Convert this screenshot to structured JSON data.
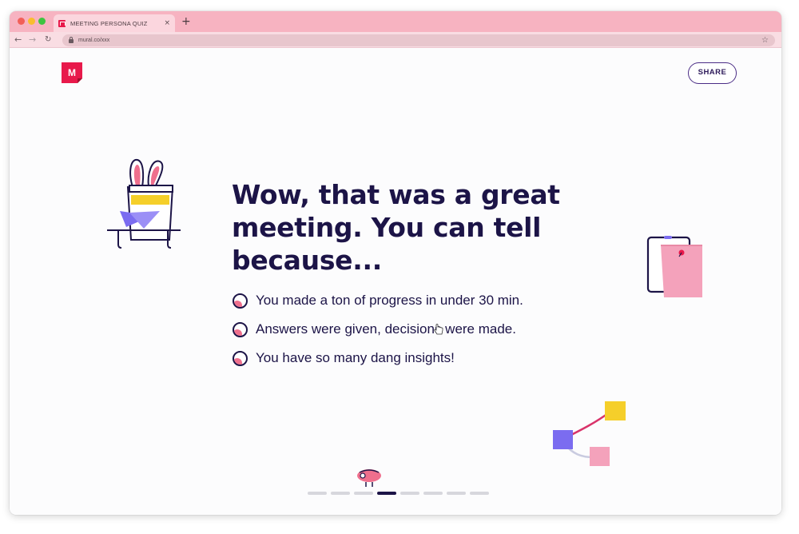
{
  "browser": {
    "tab_title": "MEETING PERSONA QUIZ",
    "tab_close": "×",
    "new_tab": "+",
    "url": "mural.co/xxx",
    "back": "←",
    "forward": "→",
    "reload": "↻",
    "star": "☆"
  },
  "header": {
    "logo_letter": "M",
    "share_label": "SHARE"
  },
  "question": {
    "headline": "Wow, that was a great meeting. You can tell because...",
    "options": [
      "You made a ton of progress in under 30 min.",
      "Answers were given, decisions were made.",
      "You have so many dang insights!"
    ]
  },
  "progress": {
    "total_steps": 8,
    "current_step": 4
  },
  "colors": {
    "brand": "#e8194b",
    "ink": "#1c1447",
    "accent_pink": "#ef6f8d",
    "tab_strip": "#f7b3c1"
  },
  "icons": [
    "shield-lock-icon",
    "star-icon",
    "radio-icon",
    "hat-rabbit-illustration",
    "sticky-note-illustration",
    "connected-nodes-illustration",
    "character-illustration",
    "hand-cursor-icon"
  ]
}
